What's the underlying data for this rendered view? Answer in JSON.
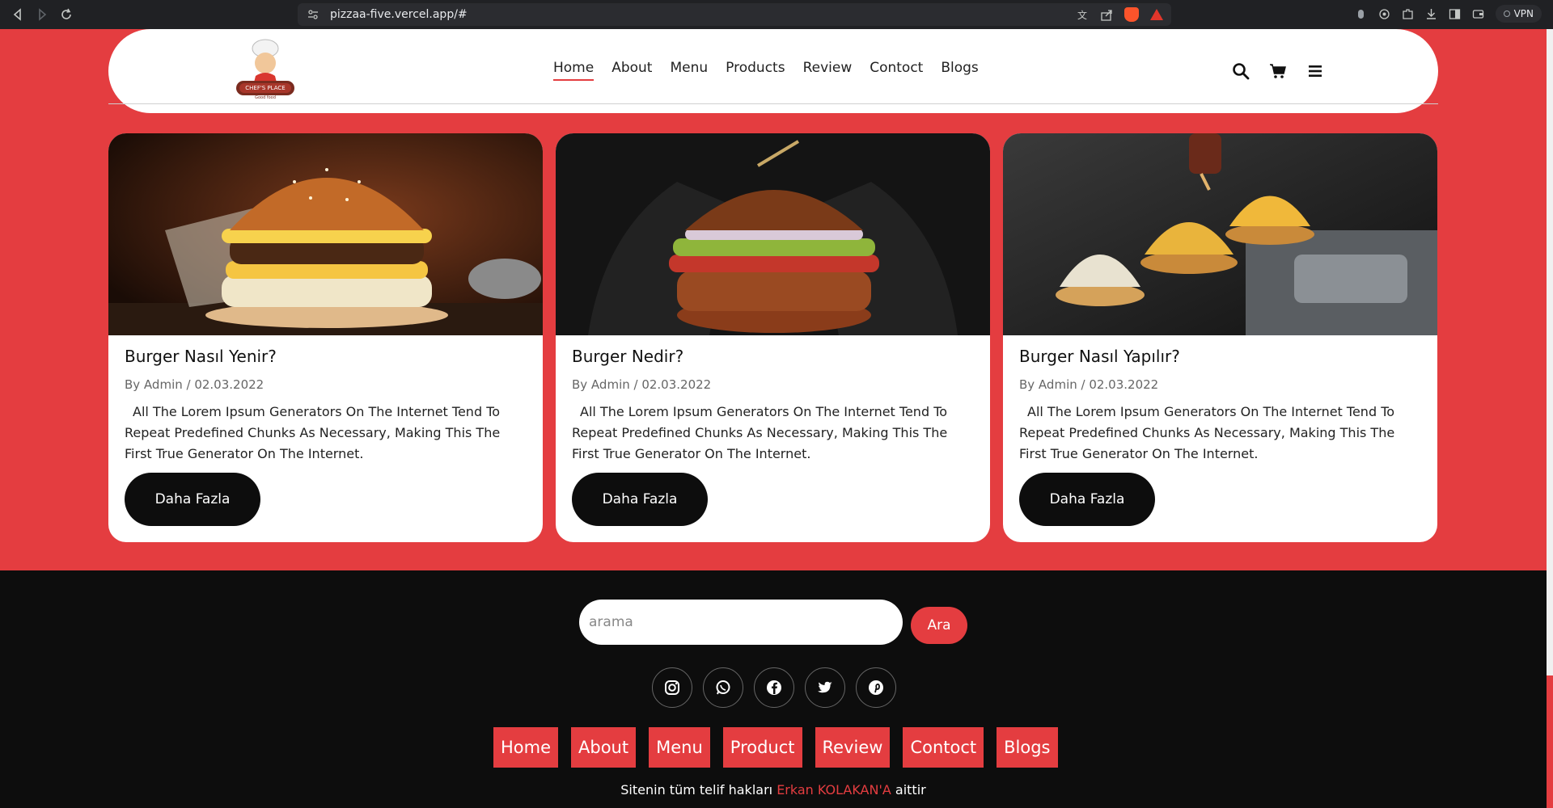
{
  "browser": {
    "url": "pizzaa-five.vercel.app/#",
    "vpn_label": "VPN"
  },
  "header": {
    "logo_alt": "Chef's Place logo",
    "nav": [
      {
        "label": "Home",
        "active": true
      },
      {
        "label": "About"
      },
      {
        "label": "Menu"
      },
      {
        "label": "Products"
      },
      {
        "label": "Review"
      },
      {
        "label": "Contoct"
      },
      {
        "label": "Blogs"
      }
    ],
    "icons": [
      "search-icon",
      "cart-icon",
      "menu-icon"
    ]
  },
  "cards": [
    {
      "title": "Burger Nasıl Yenir?",
      "meta": "By Admin / 02.03.2022",
      "text": "All The Lorem Ipsum Generators On The Internet Tend To Repeat Predefined Chunks As Necessary, Making This The First True Generator On The Internet.",
      "button": "Daha Fazla"
    },
    {
      "title": "Burger Nedir?",
      "meta": "By Admin / 02.03.2022",
      "text": "All The Lorem Ipsum Generators On The Internet Tend To Repeat Predefined Chunks As Necessary, Making This The First True Generator On The Internet.",
      "button": "Daha Fazla"
    },
    {
      "title": "Burger Nasıl Yapılır?",
      "meta": "By Admin / 02.03.2022",
      "text": "All The Lorem Ipsum Generators On The Internet Tend To Repeat Predefined Chunks As Necessary, Making This The First True Generator On The Internet.",
      "button": "Daha Fazla"
    }
  ],
  "footer": {
    "search_placeholder": "arama",
    "search_button": "Ara",
    "socials": [
      "instagram-icon",
      "whatsapp-icon",
      "facebook-icon",
      "twitter-icon",
      "pinterest-icon"
    ],
    "nav": [
      "Home",
      "About",
      "Menu",
      "Product",
      "Review",
      "Contoct",
      "Blogs"
    ],
    "copyright_prefix": "Sitenin tüm telif hakları",
    "copyright_author": "Erkan KOLAKAN'A",
    "copyright_suffix": "aittir"
  },
  "colors": {
    "accent": "#e43d40",
    "dark": "#0d0d0d",
    "white": "#ffffff"
  }
}
